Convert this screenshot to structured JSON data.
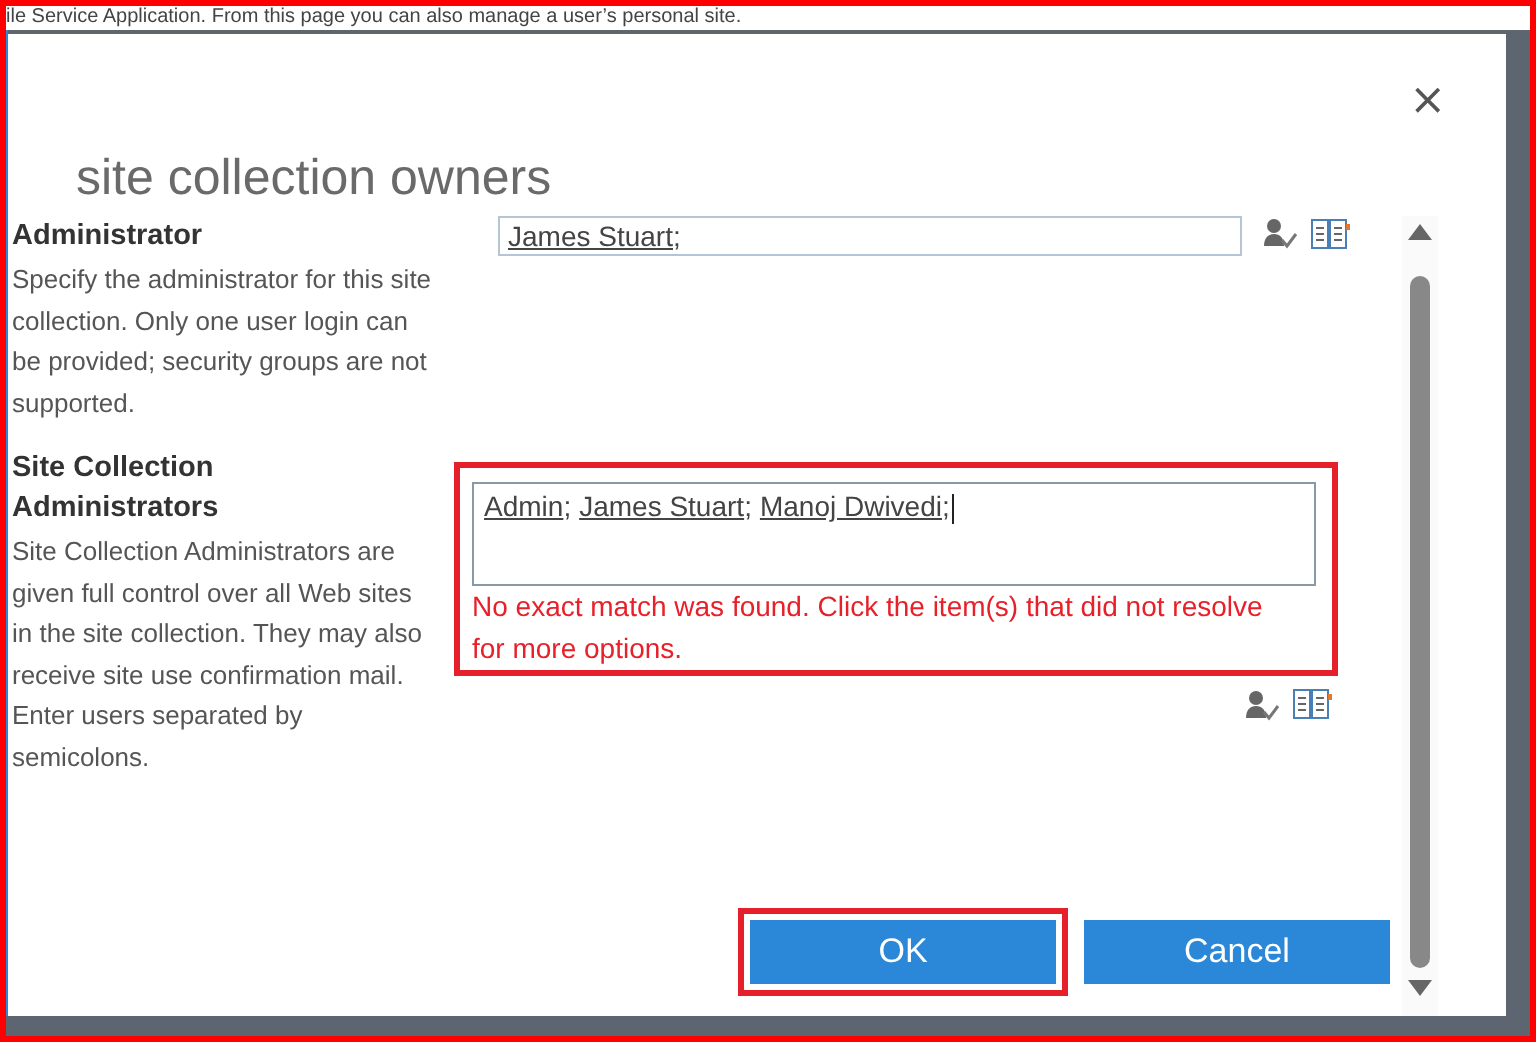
{
  "page_text": "ile Service Application. From this page you can also manage a user’s personal site.",
  "dialog": {
    "title": "site collection owners",
    "close": "×"
  },
  "sections": [
    {
      "heading": "Administrator",
      "description": "Specify the administrator for this site collection. Only one user login can be provided; security groups are not supported.",
      "kind": "single",
      "names": [
        {
          "name": "James Stuart",
          "sep": ";"
        }
      ]
    },
    {
      "heading": "Site Collection Administrators",
      "description": "Site Collection Administrators are given full control over all Web sites in the site collection. They may also receive site use confirmation mail. Enter users separated by semicolons.",
      "kind": "multi",
      "highlighted": true,
      "names": [
        {
          "name": "Admin",
          "sep": ";"
        },
        {
          "name": "James Stuart",
          "sep": ";"
        },
        {
          "name": "Manoj Dwivedi",
          "sep": ";"
        }
      ],
      "error": "No exact match was found. Click the item(s) that did not resolve for more options."
    }
  ],
  "buttons": [
    {
      "label": "OK",
      "highlighted": true
    },
    {
      "label": "Cancel",
      "highlighted": false
    }
  ]
}
